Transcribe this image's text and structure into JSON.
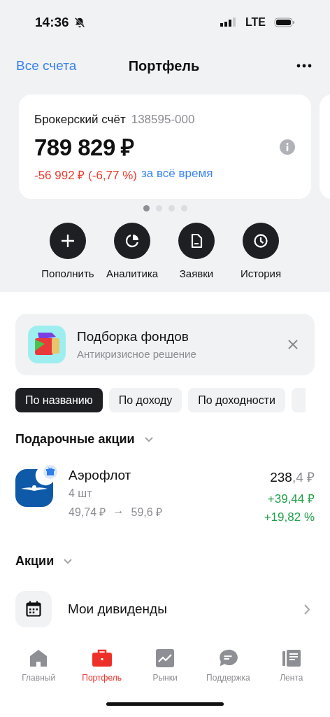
{
  "status_bar": {
    "time": "14:36",
    "network": "LTE"
  },
  "header": {
    "back_link": "Все счета",
    "title": "Портфель"
  },
  "account_card": {
    "name": "Брокерский счёт",
    "number": "138595-000",
    "balance": "789 829 ₽",
    "change": "-56 992 ₽ (-6,77 %)",
    "period": "за всё время"
  },
  "pager_dots": [
    {
      "selected": true
    },
    {
      "selected": false
    },
    {
      "selected": false
    },
    {
      "selected": false
    }
  ],
  "actions": [
    {
      "kind": "plus",
      "label": "Пополнить"
    },
    {
      "kind": "analytics",
      "label": "Аналитика"
    },
    {
      "kind": "document",
      "label": "Заявки"
    },
    {
      "kind": "clock",
      "label": "История"
    }
  ],
  "promo": {
    "title": "Подборка фондов",
    "subtitle": "Антикризисное решение"
  },
  "sort_chips": [
    {
      "label": "По названию",
      "selected": true
    },
    {
      "label": "По доходу",
      "selected": false
    },
    {
      "label": "По доходности",
      "selected": false
    }
  ],
  "gift_section": {
    "title": "Подарочные акции",
    "expanded": true,
    "positions": [
      {
        "name": "Аэрофлот",
        "quantity": "4 шт",
        "buy_price": "49,74 ₽",
        "arrow": "→",
        "current_price": "59,6 ₽",
        "value_whole": "238",
        "value_fraction": ",4 ₽",
        "profit": "+39,44 ₽",
        "profit_percent": "+19,82 %"
      }
    ]
  },
  "stocks_section": {
    "title": "Акции",
    "expanded": true
  },
  "dividends": {
    "label": "Мои дивиденды"
  },
  "tab_bar": [
    {
      "kind": "home",
      "label": "Главный",
      "selected": false
    },
    {
      "kind": "briefcase",
      "label": "Портфель",
      "selected": true
    },
    {
      "kind": "chart",
      "label": "Рынки",
      "selected": false
    },
    {
      "kind": "chat",
      "label": "Поддержка",
      "selected": false
    },
    {
      "kind": "feed",
      "label": "Лента",
      "selected": false
    }
  ]
}
